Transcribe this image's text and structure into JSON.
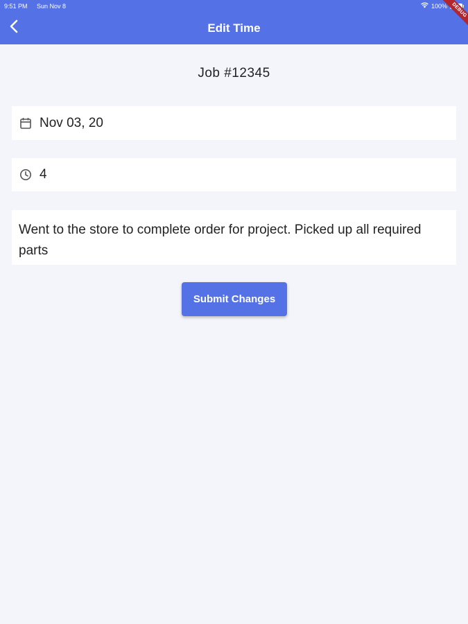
{
  "status_bar": {
    "time": "9:51 PM",
    "date": "Sun Nov 8",
    "battery": "100%"
  },
  "appbar": {
    "title": "Edit Time",
    "back_icon": "chevron-left-icon",
    "color": "#5472e6",
    "debug_banner": "DEBUG"
  },
  "job": {
    "title": "Job #12345"
  },
  "form": {
    "date_icon": "calendar-icon",
    "date_value": "Nov 03, 20",
    "hours_icon": "clock-icon",
    "hours_value": "4",
    "notes_value": "Went to the store to complete order for project. Picked up all required parts"
  },
  "actions": {
    "submit_label": "Submit Changes"
  }
}
